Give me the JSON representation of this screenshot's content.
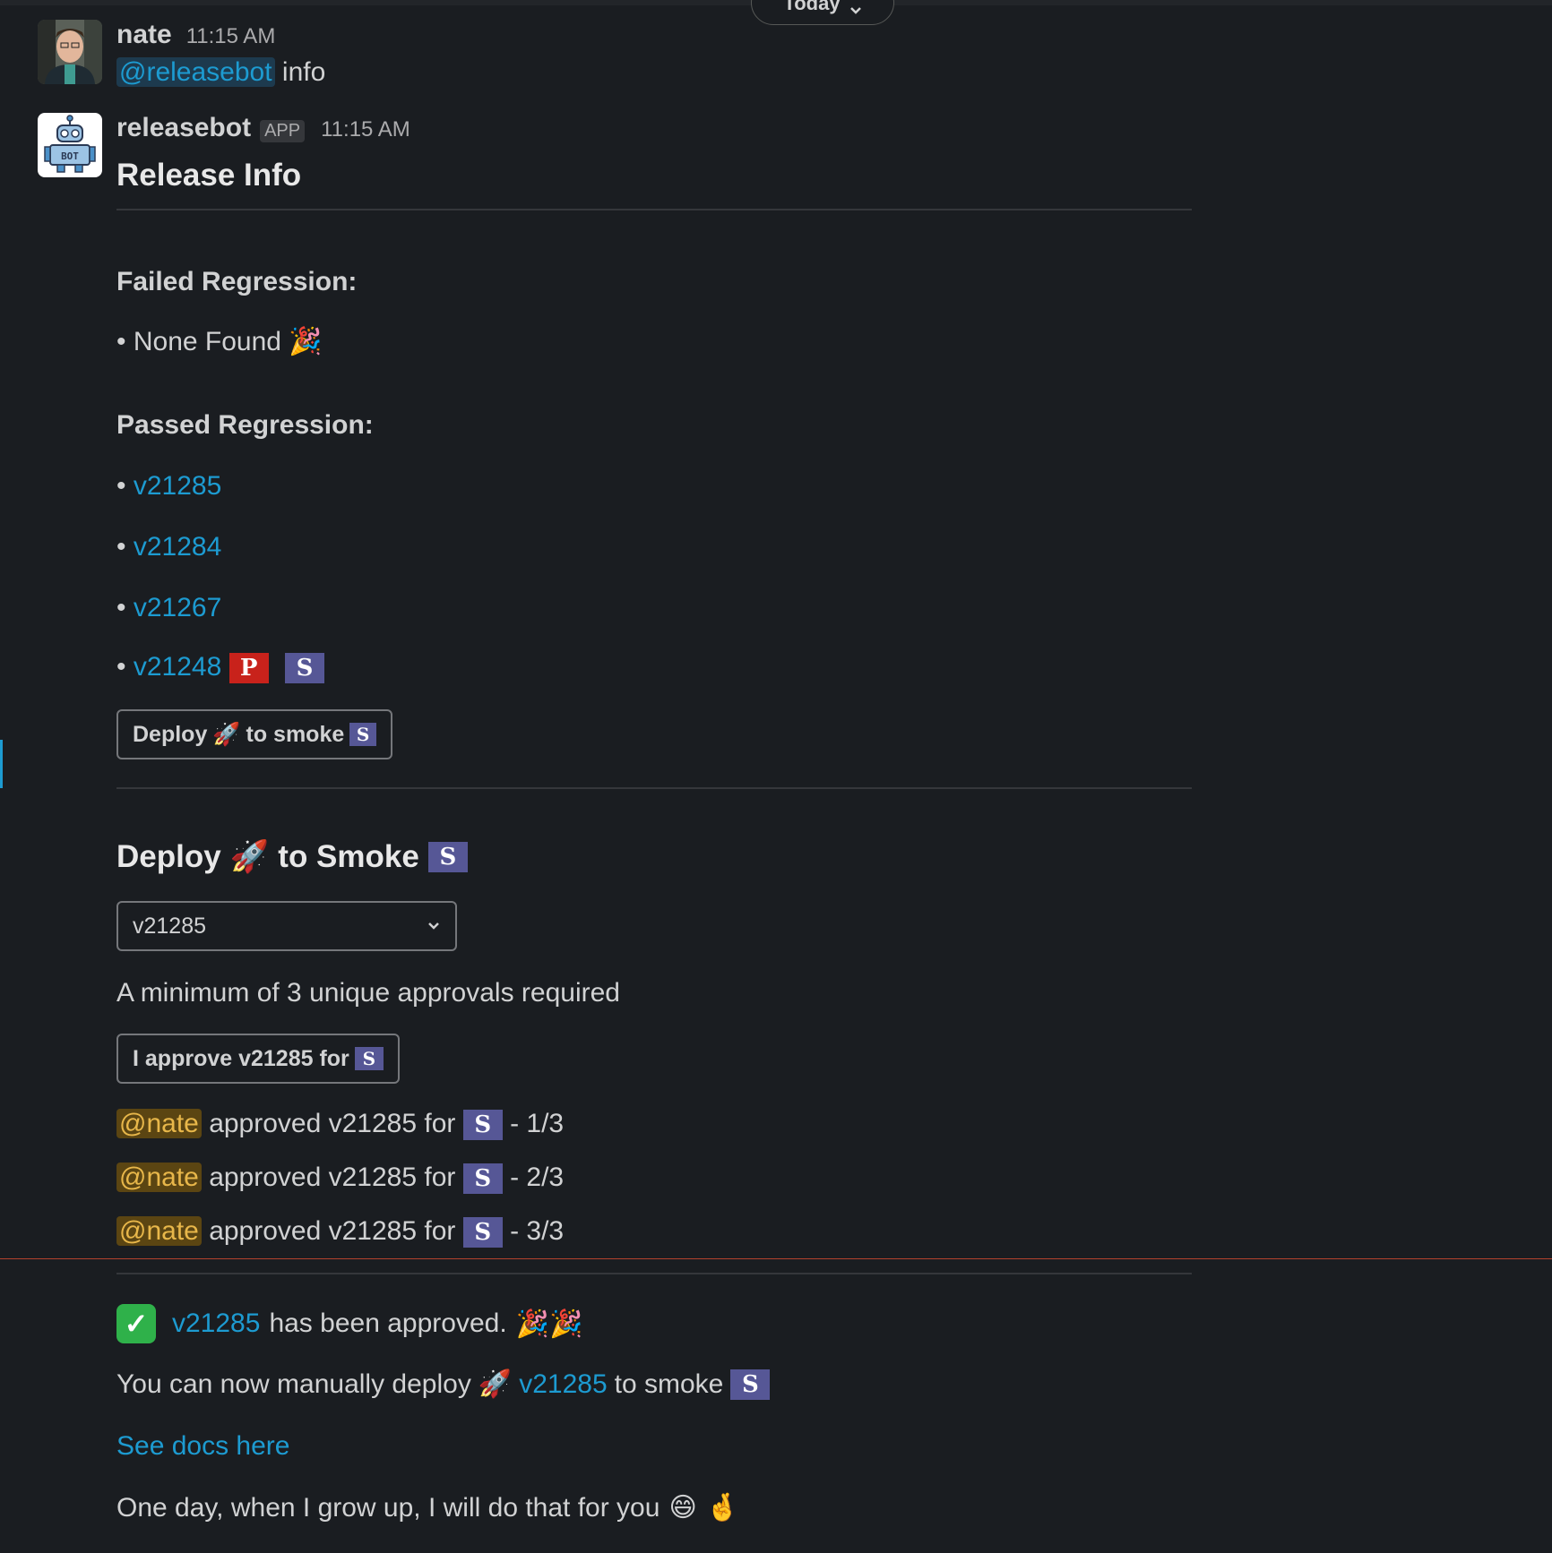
{
  "date_divider": {
    "label": "Today"
  },
  "msg1": {
    "author": "nate",
    "time": "11:15 AM",
    "mention": "@releasebot",
    "text": "info"
  },
  "msg2": {
    "author": "releasebot",
    "app_badge": "APP",
    "time": "11:15 AM",
    "heading": "Release Info",
    "failed_label": "Failed Regression:",
    "failed_items": [
      "None Found"
    ],
    "passed_label": "Passed Regression:",
    "passed_items": [
      "v21285",
      "v21284",
      "v21267",
      "v21248"
    ],
    "badge_p": "P",
    "badge_s": "S",
    "deploy_button": {
      "pre": "Deploy",
      "post": "to smoke"
    },
    "deploy_heading": {
      "pre": "Deploy",
      "post": "to Smoke"
    },
    "version_select": {
      "value": "v21285"
    },
    "approvals_required": "A minimum of 3 unique approvals required",
    "approve_button": "I approve v21285 for",
    "approvals": [
      {
        "mention": "@nate",
        "text": "approved v21285 for",
        "count": "- 1/3"
      },
      {
        "mention": "@nate",
        "text": "approved v21285 for",
        "count": "- 2/3"
      },
      {
        "mention": "@nate",
        "text": "approved v21285 for",
        "count": "- 3/3"
      }
    ],
    "approved": {
      "version": "v21285",
      "text": "has been approved."
    },
    "deploy_now": {
      "pre": "You can now manually deploy",
      "version": "v21285",
      "post": "to smoke"
    },
    "docs_link": "See docs here",
    "closing": "One day, when I grow up, I will do that for you"
  },
  "icons": {
    "party": "party-popper-icon",
    "rocket": "rocket-icon",
    "check": "check-mark-icon",
    "grin": "grinning-face-icon",
    "fingers": "crossed-fingers-icon",
    "chevron": "chevron-down-icon"
  },
  "colors": {
    "background": "#1a1d21",
    "link": "#1d9bd1",
    "badge_p": "#c8221b",
    "badge_s": "#565796",
    "check": "#2fb14a"
  }
}
